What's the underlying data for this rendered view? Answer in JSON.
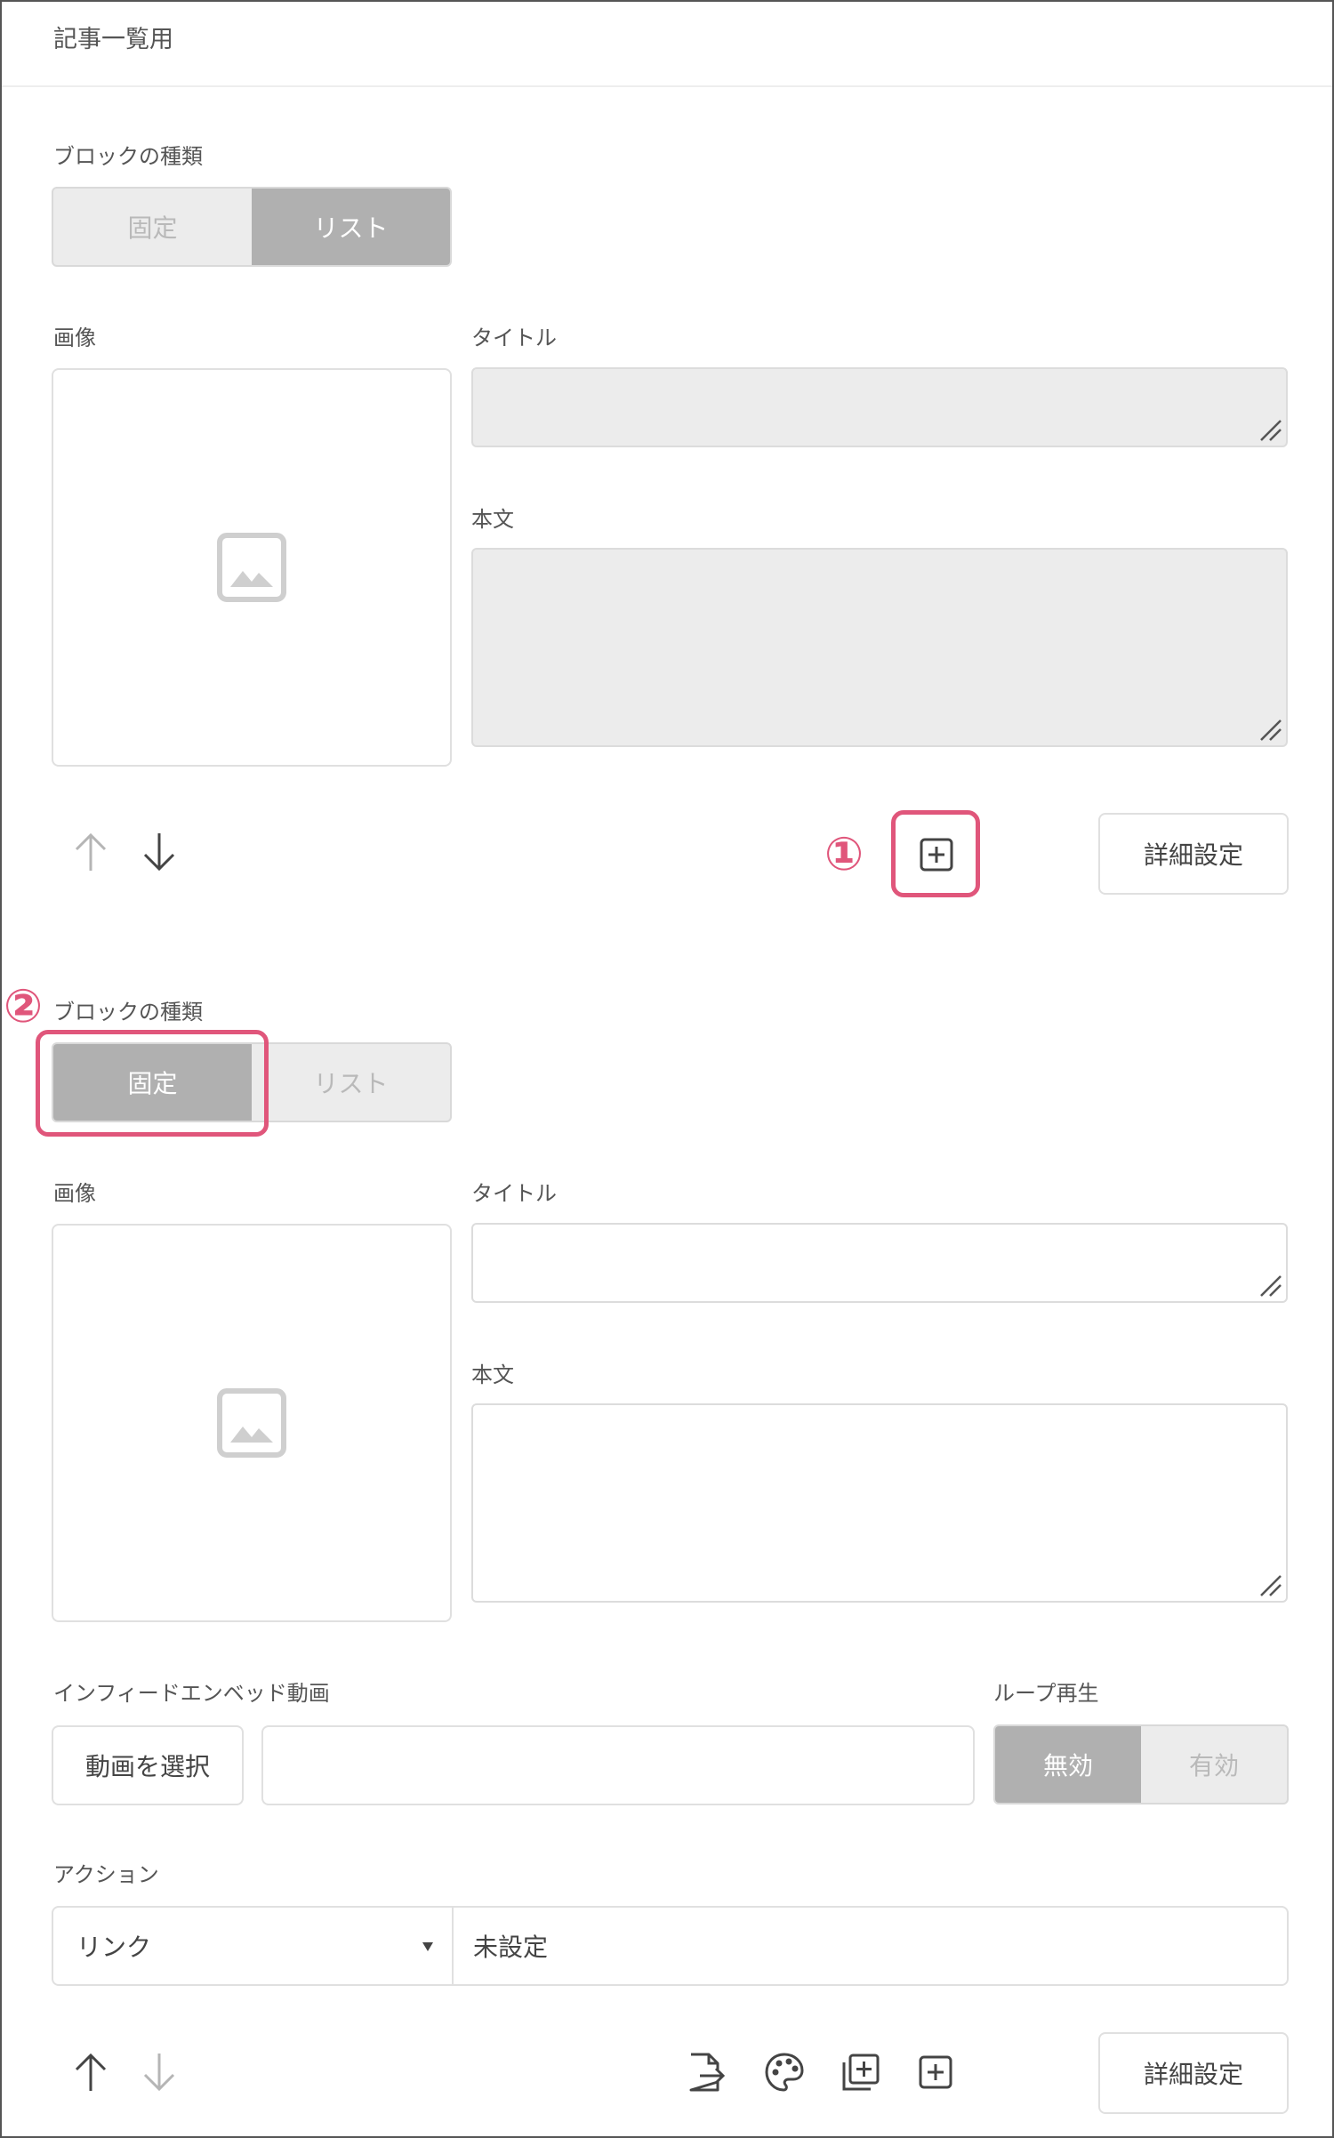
{
  "header": {
    "title": "記事一覧用"
  },
  "block1": {
    "type_label": "ブロックの種類",
    "types": [
      "固定",
      "リスト"
    ],
    "selected": "リスト",
    "image_label": "画像",
    "title_label": "タイトル",
    "body_label": "本文",
    "settings_label": "詳細設定",
    "marker": "①"
  },
  "block2": {
    "type_label": "ブロックの種類",
    "types": [
      "固定",
      "リスト"
    ],
    "selected": "固定",
    "image_label": "画像",
    "title_label": "タイトル",
    "body_label": "本文",
    "video_label": "インフィードエンベッド動画",
    "video_button": "動画を選択",
    "loop_label": "ループ再生",
    "loop_options": [
      "無効",
      "有効"
    ],
    "loop_selected": "無効",
    "action_label": "アクション",
    "action_type": "リンク",
    "action_value": "未設定",
    "settings_label": "詳細設定",
    "marker": "②"
  },
  "colors": {
    "highlight": "#e0567b",
    "selected_segment": "#b0b0b0",
    "field_gray": "#ececec"
  },
  "icons": [
    "image-placeholder-icon",
    "arrow-up-icon",
    "arrow-down-icon",
    "add-block-icon",
    "file-export-icon",
    "palette-icon",
    "duplicate-icon"
  ]
}
